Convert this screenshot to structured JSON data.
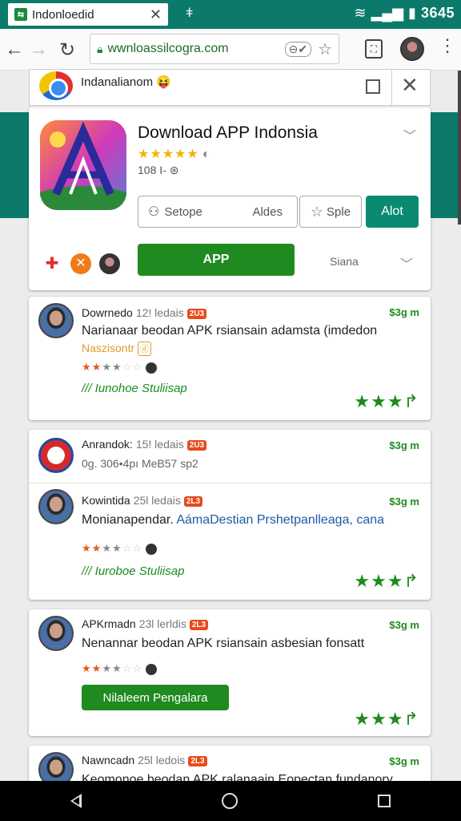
{
  "status_bar": {
    "tab_title": "Indonloedid",
    "time": "3645"
  },
  "browser": {
    "url": "wwnloassilcogra.com"
  },
  "top_card": {
    "title": "Indanalianom 😝"
  },
  "app": {
    "title": "Download APP Indonsia",
    "rating_stars": "★★★★★",
    "meta": "108 I- ⊛",
    "setup_label": "Setope",
    "setup_second": "Aldes",
    "sple_label": "Sple",
    "alot_label": "Alot",
    "app_button": "APP",
    "siana": "Siana"
  },
  "reviews": [
    {
      "author": "Dowrnedo",
      "ago": "12! ledais",
      "badge": "2U3",
      "size": "$3g m",
      "text": "Narianaar beodan APK rsiansain adamsta (imdedon",
      "sub": "Naszisontr",
      "stars": 3.5,
      "tag": "/// Iunohoe Stuliisap",
      "rating": "★★★↱"
    },
    {
      "author": "Anrandok:",
      "ago": "15! ledais",
      "badge": "2U3",
      "size": "$3g m",
      "meta": "0g. 306•4pı MeB57 sp2"
    },
    {
      "author": "Kowintida",
      "ago": "25l ledais",
      "badge": "2L3",
      "size": "$3g m",
      "text_plain": "Monianapendar.",
      "text_link": "AámaDestian Prshetpanlleaga, cana",
      "stars": 3.5,
      "tag": "/// Iuroboe Stuliisap",
      "rating": "★★★↱"
    },
    {
      "author": "APKrmadn",
      "ago": "23l lerldis",
      "badge": "2L3",
      "size": "$3g m",
      "text": "Nenannar beodan APK rsiansain asbesian fonsatt",
      "stars": 3.5,
      "button": "Nilaleem Pengalara",
      "rating": "★★★↱"
    },
    {
      "author": "Nawncadn",
      "ago": "25l ledois",
      "badge": "2L3",
      "size": "$3g m",
      "text": "Keomonoe beodan APK ralanaain Eopectan fundanory"
    }
  ]
}
